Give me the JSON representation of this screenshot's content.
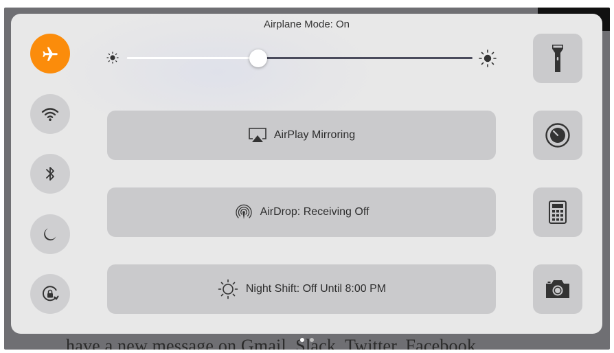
{
  "background": {
    "text": "have a new message on Gmail, Slack, Twitter, Facebook"
  },
  "status": {
    "text": "Airplane Mode: On"
  },
  "toggles": [
    {
      "name": "airplane",
      "icon": "airplane-icon",
      "active": true
    },
    {
      "name": "wifi",
      "icon": "wifi-icon",
      "active": false
    },
    {
      "name": "bluetooth",
      "icon": "bluetooth-icon",
      "active": false
    },
    {
      "name": "do-not-disturb",
      "icon": "moon-icon",
      "active": false
    },
    {
      "name": "rotation-lock",
      "icon": "rotation-lock-icon",
      "active": false
    }
  ],
  "brightness": {
    "value": 0.38,
    "min_icon": "sun-small-icon",
    "max_icon": "sun-large-icon"
  },
  "buttons": {
    "airplay": "AirPlay Mirroring",
    "airdrop": "AirDrop: Receiving Off",
    "night_shift": "Night Shift: Off Until 8:00 PM"
  },
  "shortcuts": [
    {
      "name": "flashlight",
      "icon": "flashlight-icon"
    },
    {
      "name": "timer",
      "icon": "timer-icon"
    },
    {
      "name": "calculator",
      "icon": "calculator-icon"
    },
    {
      "name": "camera",
      "icon": "camera-icon"
    }
  ],
  "pages": {
    "count": 2,
    "current": 1
  },
  "colors": {
    "active_orange": "#fb8c0b",
    "button_gray": "#cacacc",
    "panel": "#e8e8e8"
  }
}
